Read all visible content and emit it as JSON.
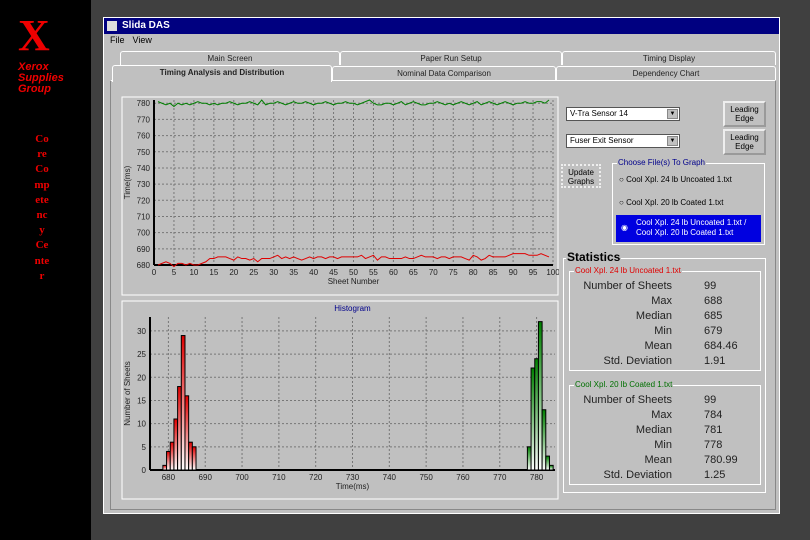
{
  "sidebar": {
    "logo_letter": "X",
    "logo_text": "Xerox Supplies Group",
    "vertical_text": "Core Competency Center"
  },
  "window": {
    "title": "Slida DAS",
    "menu": [
      "File",
      "View"
    ]
  },
  "tabs_back": [
    "Main Screen",
    "Paper Run Setup",
    "Timing Display"
  ],
  "tabs_front": [
    "Timing Analysis and Distribution",
    "Nominal Data Comparison",
    "Dependency Chart"
  ],
  "controls": {
    "sensor1": "V-Tra Sensor 14",
    "sensor2": "Fuser Exit Sensor",
    "edge1": "Leading Edge",
    "edge2": "Leading Edge",
    "update": "Update Graphs"
  },
  "file_group": {
    "title": "Choose File(s) To Graph",
    "options": [
      "Cool Xpl. 24 lb Uncoated 1.txt",
      "Cool Xpl. 20 lb Coated 1.txt",
      "Cool Xpl. 24 lb Uncoated 1.txt / Cool Xpl. 20 lb Coated 1.txt"
    ],
    "selected": 2
  },
  "statistics": {
    "title": "Statistics",
    "sets": [
      {
        "name": "Cool Xpl. 24 lb Uncoated 1.txt",
        "color": "#e00000",
        "rows": [
          [
            "Number of Sheets",
            "99"
          ],
          [
            "Max",
            "688"
          ],
          [
            "Median",
            "685"
          ],
          [
            "Min",
            "679"
          ],
          [
            "Mean",
            "684.46"
          ],
          [
            "Std. Deviation",
            "1.91"
          ]
        ]
      },
      {
        "name": "Cool Xpl. 20 lb Coated 1.txt",
        "color": "#007000",
        "rows": [
          [
            "Number of Sheets",
            "99"
          ],
          [
            "Max",
            "784"
          ],
          [
            "Median",
            "781"
          ],
          [
            "Min",
            "778"
          ],
          [
            "Mean",
            "780.99"
          ],
          [
            "Std. Deviation",
            "1.25"
          ]
        ]
      }
    ]
  },
  "chart_data": [
    {
      "type": "line",
      "title": "",
      "xlabel": "Sheet Number",
      "ylabel": "Time(ms)",
      "xlim": [
        0,
        100
      ],
      "ylim": [
        680,
        782
      ],
      "xticks": [
        0,
        5,
        10,
        15,
        20,
        25,
        30,
        35,
        40,
        45,
        50,
        55,
        60,
        65,
        70,
        75,
        80,
        85,
        90,
        95,
        100
      ],
      "yticks": [
        680,
        690,
        700,
        710,
        720,
        730,
        740,
        750,
        760,
        770,
        780
      ],
      "grid": true,
      "series": [
        {
          "color": "#e00000",
          "values": [
            680,
            681,
            682,
            681,
            679,
            681,
            681,
            680,
            681,
            680,
            680,
            681,
            682,
            684,
            684,
            685,
            685,
            685,
            684,
            683,
            685,
            684,
            684,
            683,
            684,
            682,
            684,
            684,
            684,
            685,
            686,
            684,
            685,
            684,
            685,
            684,
            683,
            684,
            685,
            684,
            685,
            685,
            684,
            685,
            685,
            684,
            685,
            685,
            685,
            685,
            685,
            686,
            684,
            685,
            686,
            683,
            685,
            685,
            684,
            684,
            684,
            684,
            685,
            684,
            684,
            685,
            686,
            685,
            685,
            685,
            684,
            685,
            685,
            684,
            685,
            685,
            685,
            684,
            683,
            686,
            685,
            683,
            684,
            686,
            685,
            685,
            685,
            685,
            686,
            687,
            687,
            687,
            687,
            686,
            686,
            686,
            687,
            686,
            685
          ]
        },
        {
          "color": "#008000",
          "values": [
            781,
            780,
            779,
            780,
            778,
            780,
            779,
            780,
            779,
            780,
            781,
            780,
            780,
            779,
            780,
            779,
            780,
            780,
            781,
            780,
            779,
            780,
            780,
            781,
            780,
            779,
            782,
            779,
            780,
            780,
            781,
            780,
            779,
            780,
            781,
            780,
            780,
            781,
            780,
            779,
            780,
            780,
            781,
            780,
            779,
            780,
            780,
            781,
            780,
            780,
            779,
            780,
            781,
            782,
            780,
            779,
            779,
            780,
            780,
            779,
            780,
            781,
            779,
            780,
            781,
            780,
            779,
            779,
            780,
            780,
            781,
            780,
            779,
            780,
            779,
            780,
            781,
            780,
            779,
            780,
            781,
            779,
            780,
            781,
            780,
            779,
            780,
            781,
            780,
            779,
            780,
            780,
            781,
            780,
            780,
            781,
            781,
            780,
            782
          ]
        }
      ]
    },
    {
      "type": "bar",
      "title": "Histogram",
      "xlabel": "Time(ms)",
      "ylabel": "Number of Sheets",
      "xlim": [
        675,
        785
      ],
      "ylim": [
        0,
        33
      ],
      "xticks": [
        680,
        690,
        700,
        710,
        720,
        730,
        740,
        750,
        760,
        770,
        780
      ],
      "yticks": [
        0,
        5,
        10,
        15,
        20,
        25,
        30
      ],
      "grid": true,
      "series": [
        {
          "color": "#e00000",
          "x": [
            679,
            680,
            681,
            682,
            683,
            684,
            685,
            686,
            687,
            688
          ],
          "values": [
            1,
            4,
            6,
            11,
            18,
            29,
            16,
            6,
            5,
            0
          ]
        },
        {
          "color": "#008000",
          "x": [
            778,
            779,
            780,
            781,
            782,
            783,
            784
          ],
          "values": [
            5,
            22,
            24,
            32,
            13,
            3,
            1
          ]
        }
      ]
    }
  ]
}
